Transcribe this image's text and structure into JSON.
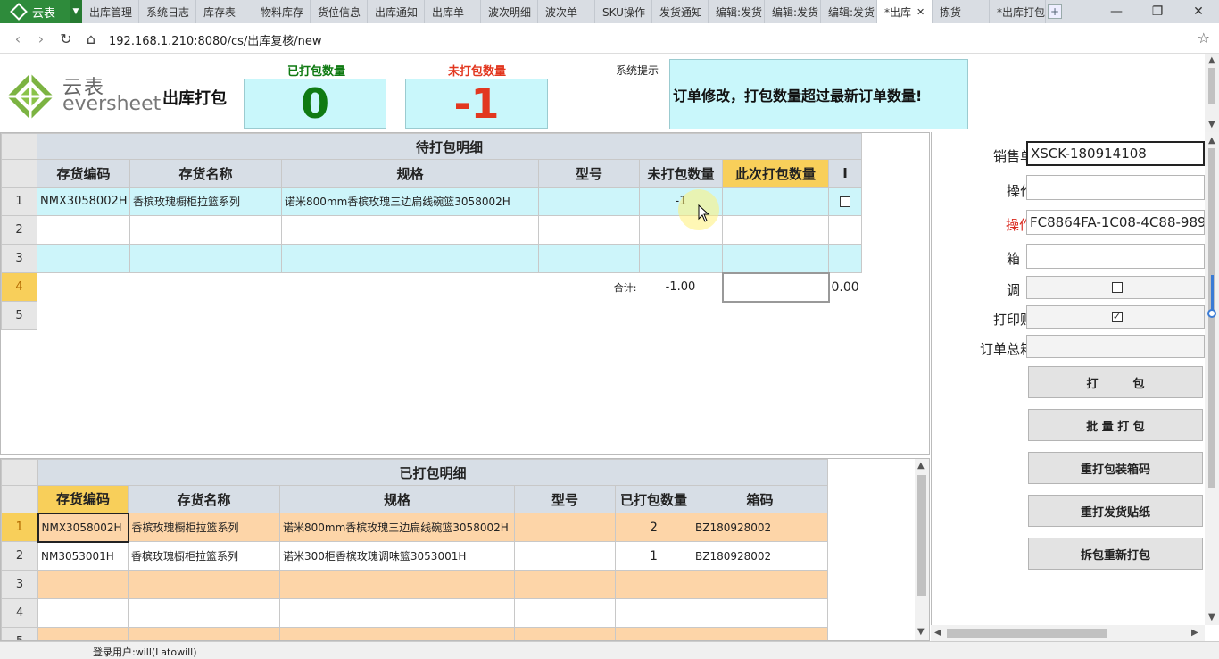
{
  "app": {
    "name": "云表"
  },
  "tabs": [
    {
      "label": "出库管理"
    },
    {
      "label": "系统日志"
    },
    {
      "label": "库存表"
    },
    {
      "label": "物料库存"
    },
    {
      "label": "货位信息"
    },
    {
      "label": "出库通知"
    },
    {
      "label": "出库单"
    },
    {
      "label": "波次明细"
    },
    {
      "label": "波次单"
    },
    {
      "label": "SKU操作"
    },
    {
      "label": "发货通知"
    },
    {
      "label": "编辑:发货"
    },
    {
      "label": "编辑:发货"
    },
    {
      "label": "编辑:发货"
    },
    {
      "label": "*出库"
    },
    {
      "label": "拣货"
    },
    {
      "label": "*出库打包"
    }
  ],
  "address": {
    "url": "192.168.1.210:8080/cs/出库复核/new"
  },
  "header": {
    "brand_cn": "云表",
    "brand_en": "eversheet",
    "page_title": "出库打包",
    "packed_label": "已打包数量",
    "packed_value": "0",
    "unpacked_label": "未打包数量",
    "unpacked_value": "-1",
    "sys_label": "系统提示",
    "sys_message": "订单修改，打包数量超过最新订单数量!"
  },
  "colors": {
    "packed": "#0f7a12",
    "unpacked": "#e2371f",
    "accent_yellow": "#f8cf5a"
  },
  "pending": {
    "title": "待打包明细",
    "columns": [
      "存货编码",
      "存货名称",
      "规格",
      "型号",
      "未打包数量",
      "此次打包数量",
      "I"
    ],
    "rows": [
      {
        "no": "1",
        "code": "NMX3058002H",
        "name": "香槟玫瑰橱柜拉篮系列",
        "spec": "诺米800mm香槟玫瑰三边扁线碗篮3058002H",
        "model": "",
        "unpacked": "-1",
        "this_pack": ""
      },
      {
        "no": "2",
        "code": "",
        "name": "",
        "spec": "",
        "model": "",
        "unpacked": "",
        "this_pack": ""
      },
      {
        "no": "3",
        "code": "",
        "name": "",
        "spec": "",
        "model": "",
        "unpacked": "",
        "this_pack": ""
      }
    ],
    "total_row_no": "4",
    "total_label": "合计:",
    "total_unpacked": "-1.00",
    "total_extra": "0.00",
    "row5_no": "5"
  },
  "packed_detail": {
    "title": "已打包明细",
    "columns": [
      "存货编码",
      "存货名称",
      "规格",
      "型号",
      "已打包数量",
      "箱码"
    ],
    "rows": [
      {
        "no": "1",
        "code": "NMX3058002H",
        "name": "香槟玫瑰橱柜拉篮系列",
        "spec": "诺米800mm香槟玫瑰三边扁线碗篮3058002H",
        "model": "",
        "qty": "2",
        "box": "BZ180928002"
      },
      {
        "no": "2",
        "code": "NM3053001H",
        "name": "香槟玫瑰橱柜拉篮系列",
        "spec": "诺米300柜香槟玫瑰调味篮3053001H",
        "model": "",
        "qty": "1",
        "box": "BZ180928002"
      },
      {
        "no": "3",
        "code": "",
        "name": "",
        "spec": "",
        "model": "",
        "qty": "",
        "box": ""
      },
      {
        "no": "4",
        "code": "",
        "name": "",
        "spec": "",
        "model": "",
        "qty": "",
        "box": ""
      },
      {
        "no": "5",
        "code": "",
        "name": "",
        "spec": "",
        "model": "",
        "qty": "",
        "box": ""
      }
    ]
  },
  "form": {
    "order_label": "销售单号:",
    "order_value": "XSCK-180914108",
    "operator_label": "操作人:",
    "operator_value": "",
    "op_id_label": "操作ID:",
    "op_id_value": "FC8864FA-1C08-4C88-989",
    "box_label": "箱　码:",
    "box_value": "",
    "debug_label": "调　试:",
    "debug_checked": false,
    "print_label": "打印贴纸:",
    "print_checked": true,
    "total_boxes_label": "订单总箱数:",
    "total_boxes_value": "",
    "btn_pack": "打　　　包",
    "btn_batch": "批 量 打 包",
    "btn_reprint_box": "重打包装箱码",
    "btn_reprint_label": "重打发货贴纸",
    "btn_unpack": "拆包重新打包"
  },
  "status": {
    "user": "登录用户:will(Latowill)"
  }
}
